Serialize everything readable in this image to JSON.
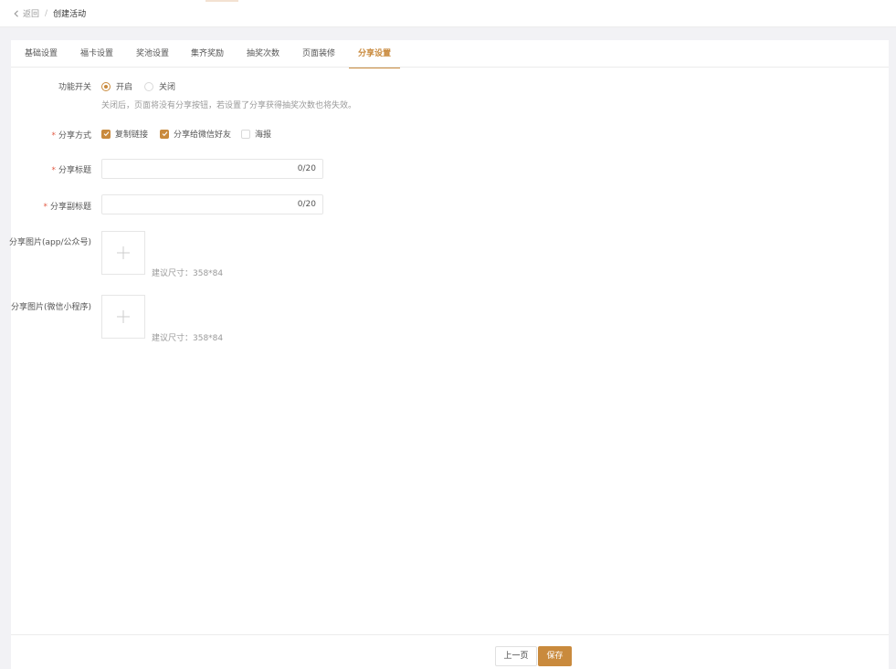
{
  "header": {
    "back_label": "返回",
    "separator": "/",
    "title": "创建活动"
  },
  "tabs": [
    {
      "label": "基础设置"
    },
    {
      "label": "福卡设置"
    },
    {
      "label": "奖池设置"
    },
    {
      "label": "集齐奖励"
    },
    {
      "label": "抽奖次数"
    },
    {
      "label": "页面装修"
    },
    {
      "label": "分享设置"
    }
  ],
  "active_tab": "分享设置",
  "form": {
    "switch": {
      "label": "功能开关",
      "options": [
        "开启",
        "关闭"
      ],
      "selected": "开启",
      "hint": "关闭后，页面将没有分享按钮，若设置了分享获得抽奖次数也将失效。"
    },
    "share_method": {
      "required_mark": "*",
      "label": "分享方式",
      "options": [
        {
          "label": "复制链接",
          "checked": true
        },
        {
          "label": "分享给微信好友",
          "checked": true
        },
        {
          "label": "海报",
          "checked": false
        }
      ]
    },
    "share_title": {
      "required_mark": "*",
      "label": "分享标题",
      "value": "",
      "counter": "0/20"
    },
    "share_subtitle": {
      "required_mark": "*",
      "label": "分享副标题",
      "value": "",
      "counter": "0/20"
    },
    "share_image_app": {
      "label": "分享图片(app/公众号)",
      "hint": "建议尺寸：358*84"
    },
    "share_image_mini": {
      "label": "分享图片(微信小程序)",
      "hint": "建议尺寸：358*84"
    }
  },
  "footer": {
    "prev_label": "上一页",
    "save_label": "保存"
  },
  "colors": {
    "accent": "#c98a3d",
    "required": "#e25b45",
    "background": "#f2f2f5"
  }
}
